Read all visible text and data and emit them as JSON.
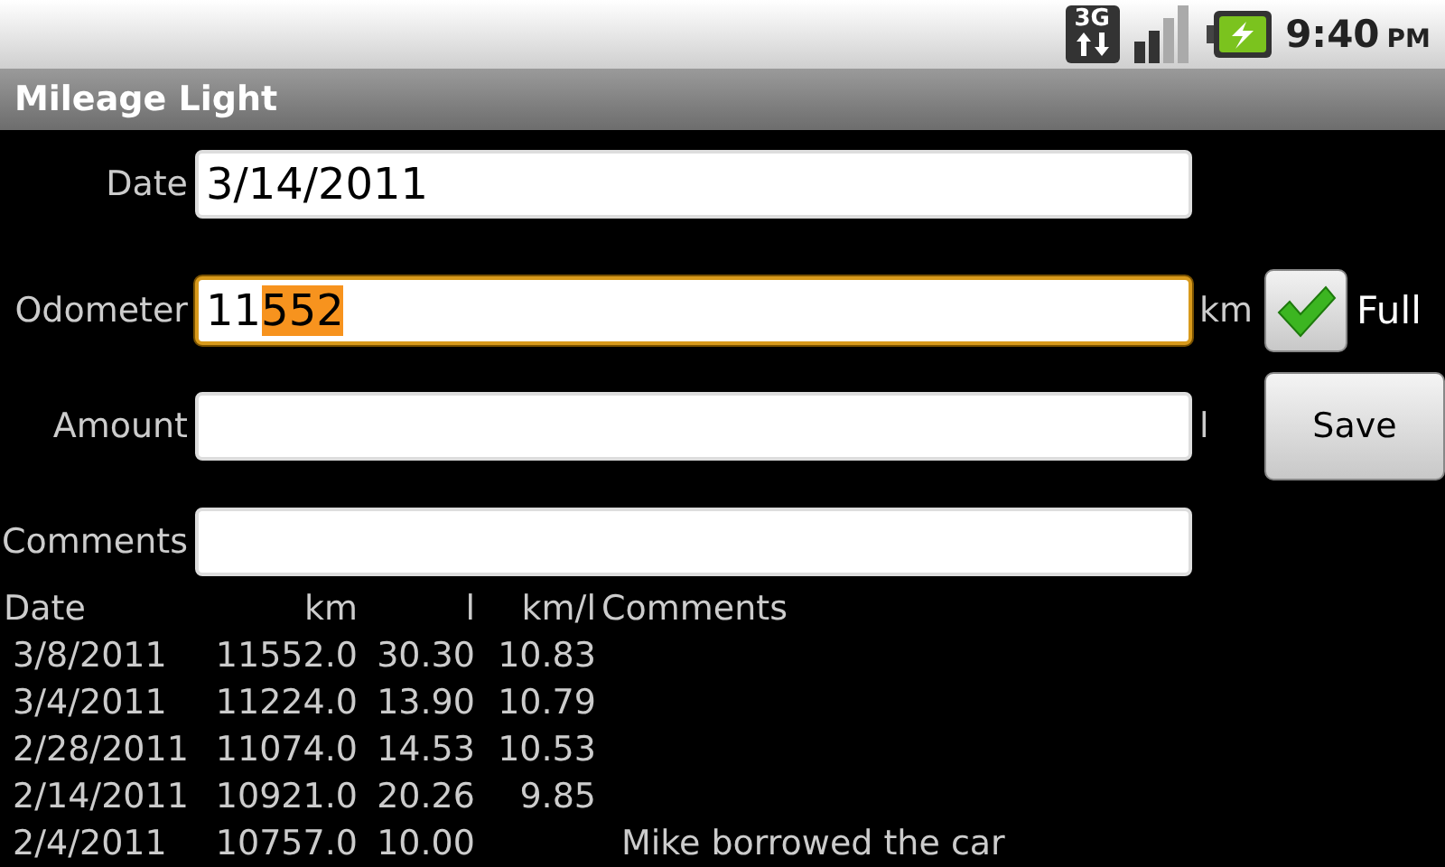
{
  "status_bar": {
    "network": "3G",
    "time": "9:40",
    "ampm": "PM"
  },
  "title": "Mileage Light",
  "form": [
    {
      "kind": "text",
      "label": "Date",
      "value_parts": [
        {
          "text": "3/14/2011",
          "selected": false
        }
      ],
      "focused": false
    },
    {
      "kind": "odometer",
      "label": "Odometer",
      "value_parts": [
        {
          "text": "11",
          "selected": false
        },
        {
          "text": "552",
          "selected": true
        }
      ],
      "focused": true,
      "unit": "km",
      "checkbox": {
        "label": "Full",
        "checked": true
      }
    },
    {
      "kind": "amount",
      "label": "Amount",
      "focused": false,
      "unit": "l",
      "button": "Save"
    },
    {
      "kind": "text",
      "label": "Comments",
      "focused": false
    }
  ],
  "table": {
    "columns": [
      "Date",
      "km",
      "l",
      "km/l",
      "Comments"
    ],
    "rows": [
      [
        "3/8/2011",
        "11552.0",
        "30.30",
        "10.83"
      ],
      [
        "3/4/2011",
        "11224.0",
        "13.90",
        "10.79"
      ],
      [
        "2/28/2011",
        "11074.0",
        "14.53",
        "10.53"
      ],
      [
        "2/14/2011",
        "10921.0",
        "20.26",
        "9.85"
      ],
      [
        "2/4/2011",
        "10757.0",
        "10.00",
        "",
        "Mike borrowed the car"
      ]
    ]
  }
}
